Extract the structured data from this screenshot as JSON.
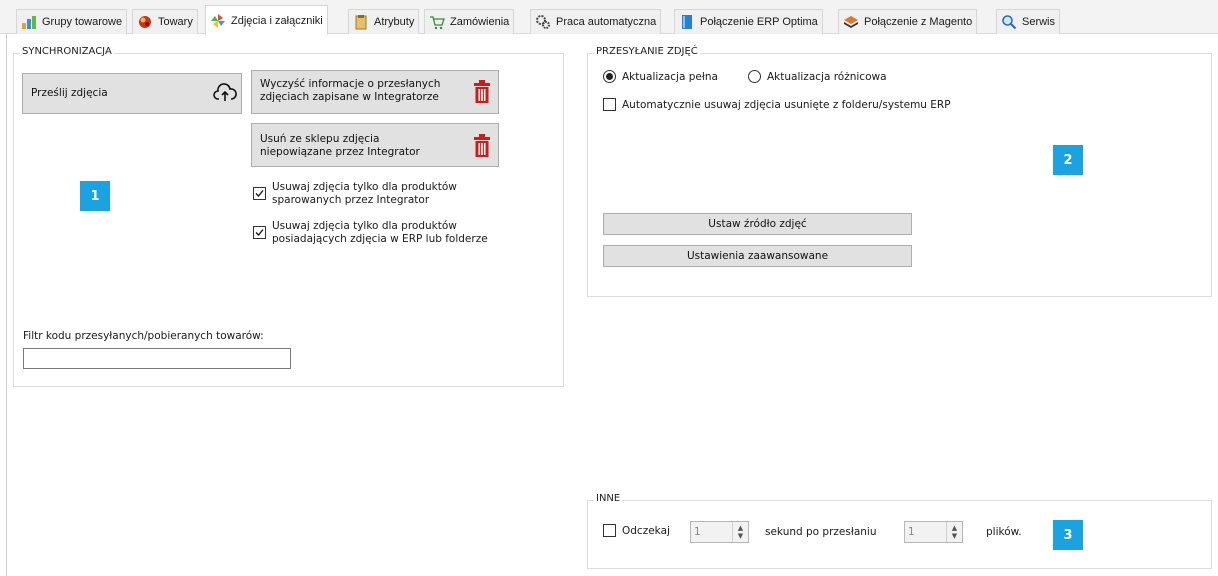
{
  "tabs": [
    {
      "label": "Grupy towarowe",
      "icon": "category-groups-icon"
    },
    {
      "label": "Towary",
      "icon": "products-icon"
    },
    {
      "label": "Zdjęcia i załączniki",
      "icon": "pinwheel-icon",
      "active": true
    },
    {
      "label": "Atrybuty",
      "icon": "attributes-icon"
    },
    {
      "label": "Zamówienia",
      "icon": "cart-icon"
    },
    {
      "label": "Praca automatyczna",
      "icon": "gears-icon"
    },
    {
      "label": "Połączenie ERP Optima",
      "icon": "book-icon"
    },
    {
      "label": "Połączenie z Magento",
      "icon": "magento-icon"
    },
    {
      "label": "Serwis",
      "icon": "magnifier-icon"
    }
  ],
  "sync": {
    "title": "SYNCHRONIZACJA",
    "upload_button": "Prześlij zdjęcia",
    "clear_button_line1": "Wyczyść informacje o przesłanych",
    "clear_button_line2": "zdjęciach zapisane w Integratorze",
    "remove_button_line1": "Usuń ze sklepu zdjęcia",
    "remove_button_line2": "niepowiązane przez Integrator",
    "check1_line1": "Usuwaj zdjęcia tylko dla produktów",
    "check1_line2": "sparowanych przez Integrator",
    "check1_checked": true,
    "check2_line1": "Usuwaj zdjęcia tylko dla produktów",
    "check2_line2": "posiadających zdjęcia w ERP lub folderze",
    "check2_checked": true,
    "filter_label": "Filtr kodu przesyłanych/pobieranych towarów:",
    "filter_value": "",
    "marker": "1"
  },
  "upload": {
    "title": "PRZESYŁANIE ZDJĘĆ",
    "radio_full": "Aktualizacja pełna",
    "radio_full_selected": true,
    "radio_diff": "Aktualizacja różnicowa",
    "auto_remove": "Automatycznie usuwaj zdjęcia usunięte z folderu/systemu ERP",
    "auto_remove_checked": false,
    "source_button": "Ustaw źródło zdjęć",
    "advanced_button": "Ustawienia zaawansowane",
    "marker": "2"
  },
  "other": {
    "title": "INNE",
    "wait_label": "Odczekaj",
    "wait_checked": false,
    "seconds_value": "1",
    "after_label": "sekund po przesłaniu",
    "files_value": "1",
    "files_label": "plików.",
    "marker": "3"
  },
  "colors": {
    "accent_marker": "#1aa3e0",
    "trash_red": "#d11b1b"
  }
}
